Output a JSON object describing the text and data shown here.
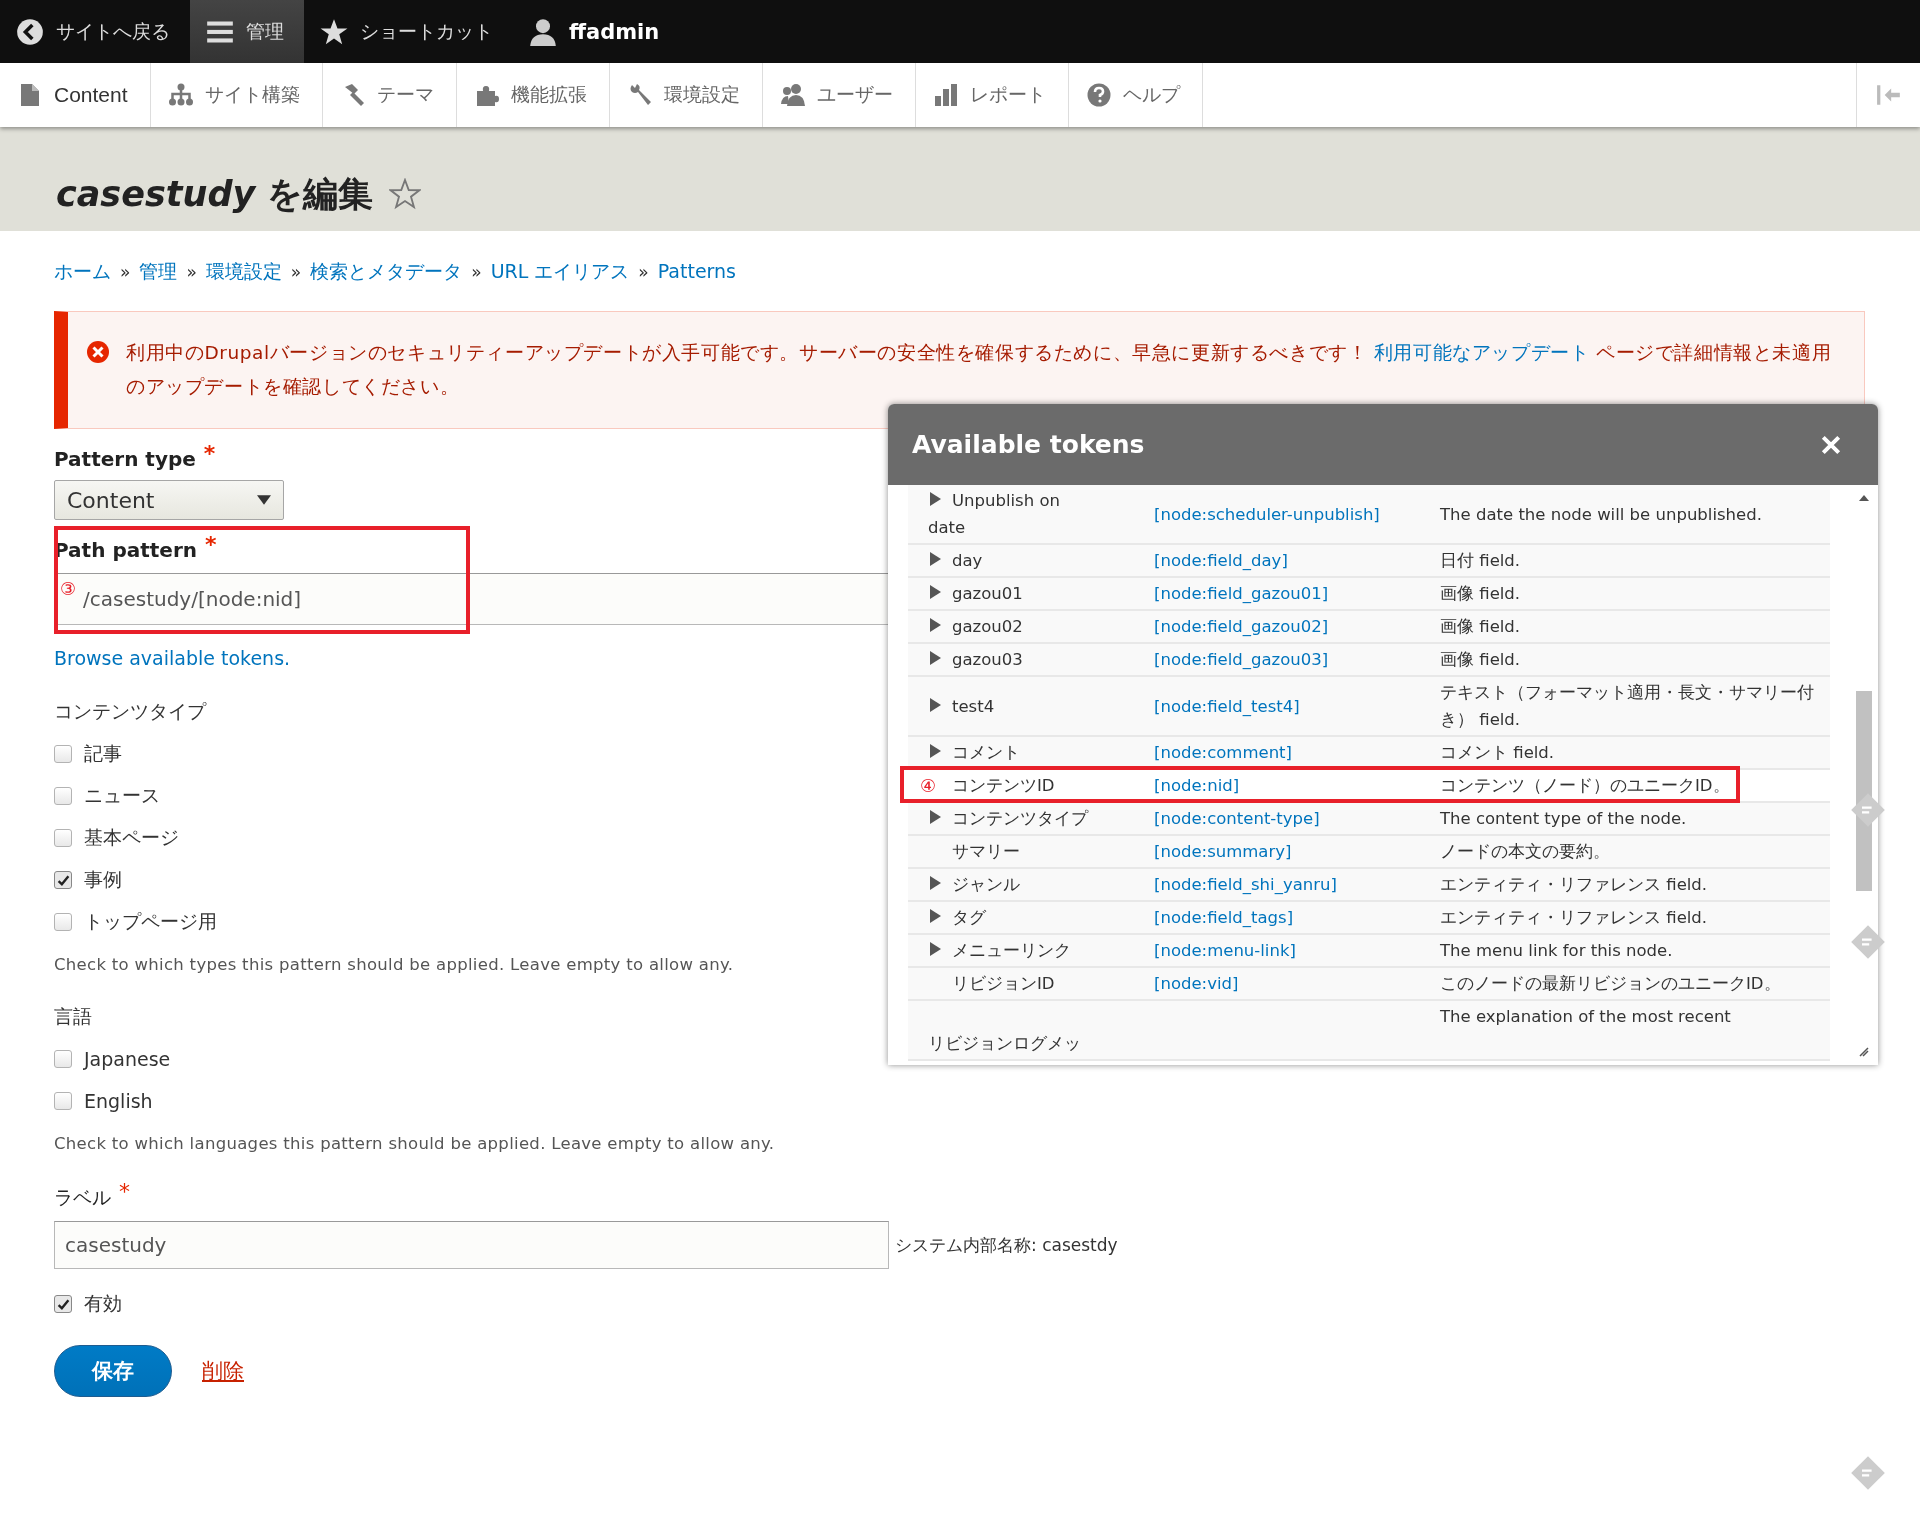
{
  "toolbar": {
    "items": [
      {
        "kind": "back",
        "label": "サイトへ戻る",
        "selected": false
      },
      {
        "kind": "menu",
        "label": "管理",
        "selected": true
      },
      {
        "kind": "star",
        "label": "ショートカット",
        "selected": false
      },
      {
        "kind": "user",
        "label": "ffadmin",
        "selected": false
      }
    ]
  },
  "tray": {
    "items": [
      {
        "kind": "file",
        "label": "Content"
      },
      {
        "kind": "sitemap",
        "label": "サイト構築"
      },
      {
        "kind": "brush",
        "label": "テーマ"
      },
      {
        "kind": "puzzle",
        "label": "機能拡張"
      },
      {
        "kind": "wrench",
        "label": "環境設定"
      },
      {
        "kind": "people",
        "label": "ユーザー"
      },
      {
        "kind": "chart",
        "label": "レポート"
      },
      {
        "kind": "help",
        "label": "ヘルプ"
      }
    ]
  },
  "page_title": "*casestudy* を編集",
  "breadcrumb": {
    "separator": "»",
    "items": [
      "ホーム",
      "管理",
      "環境設定",
      "検索とメタデータ",
      "URL エイリアス",
      "Patterns"
    ]
  },
  "alert": {
    "text_before": "利用中のDrupalバージョンのセキュリティーアップデートが入手可能です。サーバーの安全性を確保するために、早急に更新するべきです！ ",
    "link": "利用可能なアップデート",
    "text_after": " ページで詳細情報と未適用のアップデートを確認してください。"
  },
  "form": {
    "pattern_type": {
      "label": "Pattern type",
      "required_mark": "*",
      "value": "Content"
    },
    "path_pattern": {
      "label": "Path pattern",
      "required_mark": "*",
      "value": "/casestudy/[node:nid]",
      "annotation": "③"
    },
    "browse_link": "Browse available tokens.",
    "content_types": {
      "label": "コンテンツタイプ",
      "options": [
        {
          "label": "記事",
          "checked": false
        },
        {
          "label": "ニュース",
          "checked": false
        },
        {
          "label": "基本ページ",
          "checked": false
        },
        {
          "label": "事例",
          "checked": true
        },
        {
          "label": "トップページ用",
          "checked": false
        }
      ],
      "description": "Check to which types this pattern should be applied. Leave empty to allow any."
    },
    "languages": {
      "label": "言語",
      "options": [
        {
          "label": "Japanese",
          "checked": false
        },
        {
          "label": "English",
          "checked": false
        }
      ],
      "description": "Check to which languages this pattern should be applied. Leave empty to allow any."
    },
    "label_field": {
      "label": "ラベル",
      "required_mark": "*",
      "value": "casestudy",
      "machine_name": "システム内部名称: casestdy"
    },
    "enabled": {
      "label": "有効",
      "checked": true
    },
    "save_button": "保存",
    "delete_link": "削除"
  },
  "modal": {
    "title": "Available tokens",
    "rows": [
      {
        "name": "Unpublish on date",
        "expandable": true,
        "token": "[node:scheduler-unpublish]",
        "description": "The date the node will be unpublished."
      },
      {
        "name": "day",
        "expandable": true,
        "token": "[node:field_day]",
        "description": "日付 field."
      },
      {
        "name": "gazou01",
        "expandable": true,
        "token": "[node:field_gazou01]",
        "description": "画像 field."
      },
      {
        "name": "gazou02",
        "expandable": true,
        "token": "[node:field_gazou02]",
        "description": "画像 field."
      },
      {
        "name": "gazou03",
        "expandable": true,
        "token": "[node:field_gazou03]",
        "description": "画像 field."
      },
      {
        "name": "test4",
        "expandable": true,
        "token": "[node:field_test4]",
        "description": "テキスト（フォーマット適用・長文・サマリー付き） field."
      },
      {
        "name": "コメント",
        "expandable": true,
        "token": "[node:comment]",
        "description": "コメント field."
      },
      {
        "name": "コンテンツID",
        "expandable": false,
        "token": "[node:nid]",
        "description": "コンテンツ（ノード）のユニークID。",
        "annotation": "④"
      },
      {
        "name": "コンテンツタイプ",
        "expandable": true,
        "token": "[node:content-type]",
        "description": "The content type of the node."
      },
      {
        "name": "サマリー",
        "expandable": false,
        "token": "[node:summary]",
        "description": "ノードの本文の要約。"
      },
      {
        "name": "ジャンル",
        "expandable": true,
        "token": "[node:field_shi_yanru]",
        "description": "エンティティ・リファレンス field."
      },
      {
        "name": "タグ",
        "expandable": true,
        "token": "[node:field_tags]",
        "description": "エンティティ・リファレンス field."
      },
      {
        "name": "メニューリンク",
        "expandable": true,
        "token": "[node:menu-link]",
        "description": "The menu link for this node."
      },
      {
        "name": "リビジョンID",
        "expandable": false,
        "token": "[node:vid]",
        "description": "このノードの最新リビジョンのユニークID。"
      },
      {
        "name": "リビジョンログメッ",
        "expandable": false,
        "description": "The explanation of the most recent"
      }
    ]
  }
}
